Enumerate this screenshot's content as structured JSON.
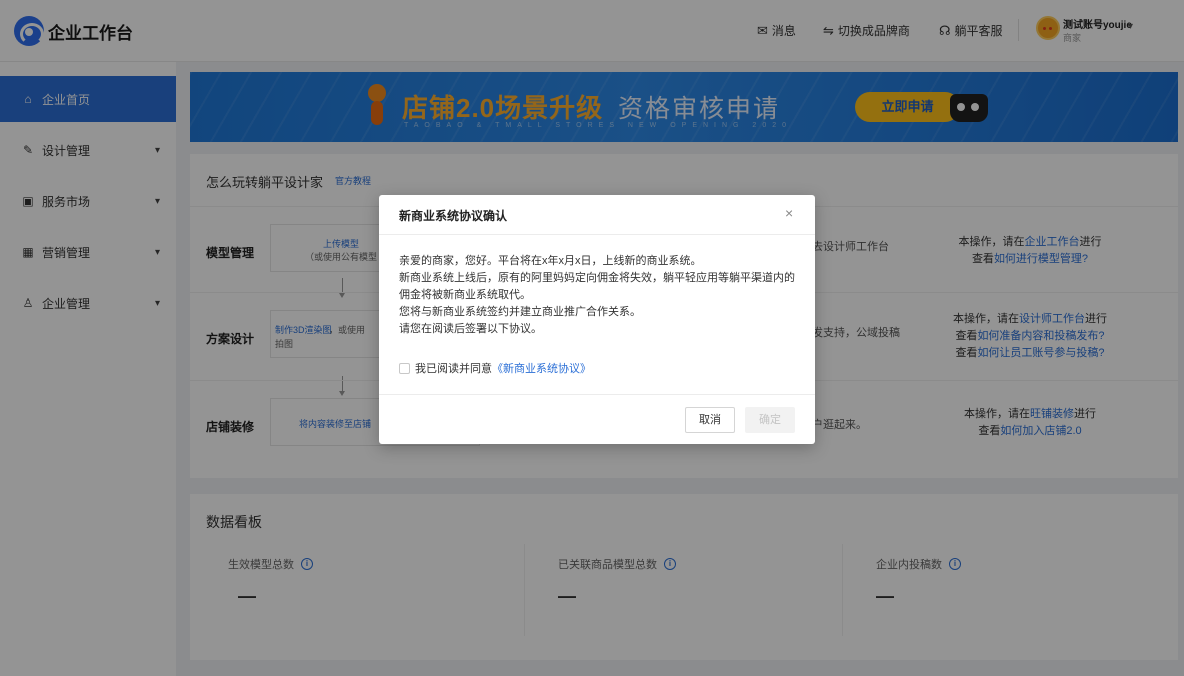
{
  "header": {
    "logo_text": "企业工作台",
    "messages_label": "消息",
    "switch_label": "切换成品牌商",
    "service_label": "躺平客服",
    "user_name": "测试账号youjie",
    "user_role": "商家"
  },
  "sidebar": {
    "items": [
      {
        "label": "企业首页",
        "icon": "home-icon",
        "active": true
      },
      {
        "label": "设计管理",
        "icon": "design-icon"
      },
      {
        "label": "服务市场",
        "icon": "market-icon"
      },
      {
        "label": "营销管理",
        "icon": "grid-icon"
      },
      {
        "label": "企业管理",
        "icon": "company-icon"
      }
    ]
  },
  "banner": {
    "title_main": "店铺2.0场景升级",
    "title_sub": "资格审核申请",
    "subtitle": "TAOBAO & TMALL STORES NEW OPENING 2020",
    "button": "立即申请",
    "brand_color": "#2d8ae8",
    "accent_color": "#ffc21a"
  },
  "guide": {
    "title": "怎么玩转躺平设计家",
    "link": "官方教程",
    "rows": [
      {
        "label": "模型管理",
        "step_line1": "上传模型",
        "step_line2": "（或使用公有模型",
        "middle": "去设计师工作台",
        "right_line1_pre": "本操作，请在",
        "right_line1_link": "企业工作台",
        "right_line1_post": "进行",
        "right_line2_pre": "查看",
        "right_line2_link": "如何进行模型管理?"
      },
      {
        "label": "方案设计",
        "step_line1_link": "制作3D渲染图",
        "step_line1_rest": "，或使用",
        "step_line2": "拍图",
        "middle": "发支持，公域投稿",
        "right_line1_pre": "本操作，请在",
        "right_line1_link": "设计师工作台",
        "right_line1_post": "进行",
        "right_line2_pre": "查看",
        "right_line2_link": "如何准备内容和投稿发布?",
        "right_line3_pre": "查看",
        "right_line3_link": "如何让员工账号参与投稿?"
      },
      {
        "label": "店铺装修",
        "step_line1": "将内容装修至店铺",
        "middle": "户逛起来。",
        "right_line1_pre": "本操作，请在",
        "right_line1_link": "旺铺装修",
        "right_line1_post": "进行",
        "right_line2_pre": "查看",
        "right_line2_link": "如何加入店铺2.0"
      }
    ]
  },
  "dashboard": {
    "title": "数据看板",
    "stats": [
      {
        "label": "生效模型总数",
        "value": "—"
      },
      {
        "label": "已关联商品模型总数",
        "value": "—"
      },
      {
        "label": "企业内投稿数",
        "value": "—"
      }
    ]
  },
  "modal": {
    "title": "新商业系统协议确认",
    "close": "×",
    "lines": [
      "亲爱的商家，您好。平台将在x年x月x日，上线新的商业系统。",
      "新商业系统上线后，原有的阿里妈妈定向佣金将失效，躺平轻应用等躺平渠道内的佣金将被新商业系统取代。",
      "您将与新商业系统签约并建立商业推广合作关系。",
      "请您在阅读后签署以下协议。"
    ],
    "agree_text": "我已阅读并同意",
    "agree_link": "《新商业系统协议》",
    "agreed": false,
    "cancel": "取消",
    "confirm": "确定"
  }
}
